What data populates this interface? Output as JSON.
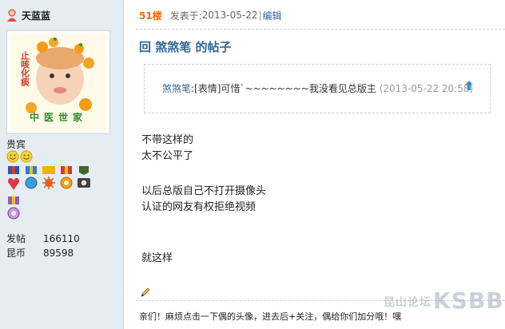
{
  "user": {
    "name": "天蓝蓝",
    "group": "贵宾",
    "stats": [
      {
        "label": "发帖",
        "value": "166110"
      },
      {
        "label": "昆币",
        "value": "89598"
      }
    ]
  },
  "avatar": {
    "top_text": "止咳化痰",
    "bottom_text": "中医世家"
  },
  "post": {
    "floor": "51楼",
    "posted_prefix": "发表于: ",
    "posted_time": "2013-05-22",
    "separator": "|",
    "edit_label": "编辑",
    "title": "回 煞煞笔 的帖子",
    "quote": {
      "author": "煞煞笔",
      "text": ":[表情]可惜`~~~~~~~~我没看见总版主 ",
      "time": "(2013-05-22 20:58)"
    },
    "body_lines": [
      "不带这样的",
      "太不公平了",
      "以后总版自己不打开摄像头",
      "认证的网友有权拒绝视频",
      "就这样"
    ],
    "signature": "亲们！麻烦点击一下偶的头像，进去后+关注，偶给你们加分哦！嘿"
  },
  "watermark": {
    "small": "昆山论坛",
    "big": "KSBBS"
  }
}
